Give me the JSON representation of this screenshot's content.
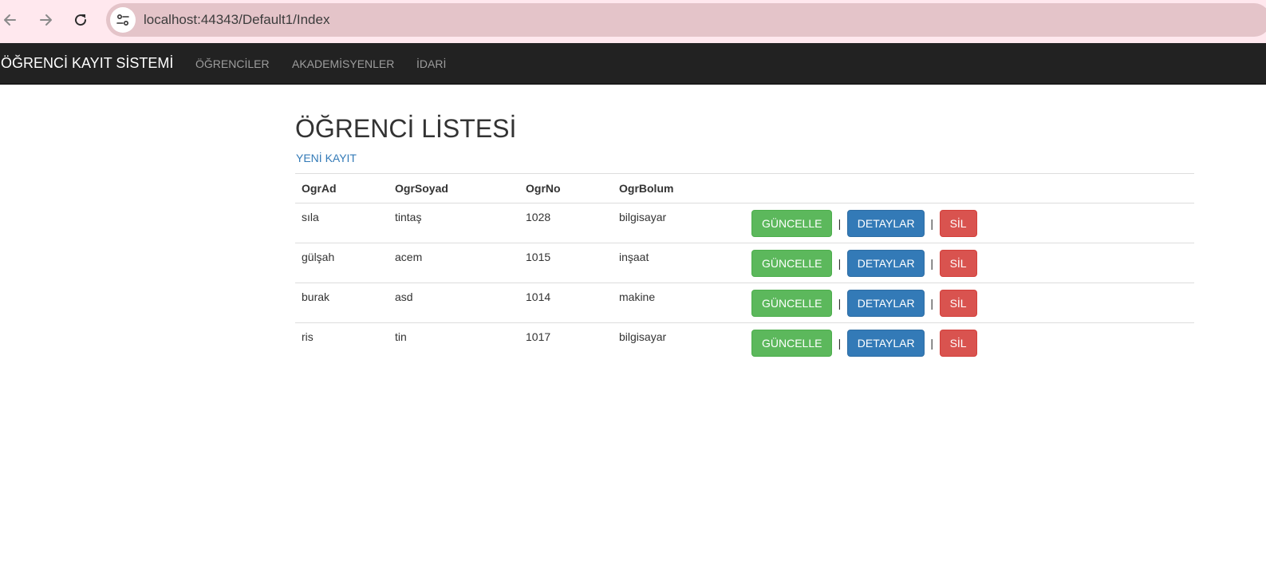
{
  "browser": {
    "url": "localhost:44343/Default1/Index",
    "icons": {
      "back": "arrow-left-icon",
      "forward": "arrow-right-icon",
      "reload": "reload-icon",
      "site_info": "tune-icon"
    }
  },
  "navbar": {
    "brand": "ÖĞRENCİ KAYIT SİSTEMİ",
    "links": [
      "ÖĞRENCİLER",
      "AKADEMİSYENLER",
      "İDARİ"
    ]
  },
  "main": {
    "title": "ÖĞRENCİ LİSTESİ",
    "new_record_link": "YENİ KAYIT",
    "table": {
      "headers": [
        "OgrAd",
        "OgrSoyad",
        "OgrNo",
        "OgrBolum"
      ],
      "rows": [
        [
          "sıla",
          "tintaş",
          "1028",
          "bilgisayar"
        ],
        [
          "gülşah",
          "acem",
          "1015",
          "inşaat"
        ],
        [
          "burak",
          "asd",
          "1014",
          "makine"
        ],
        [
          "ris",
          "tin",
          "1017",
          "bilgisayar"
        ]
      ],
      "actions": {
        "update": "GÜNCELLE",
        "details": "DETAYLAR",
        "delete": "SİL",
        "separator": "|"
      }
    }
  },
  "colors": {
    "navbar_bg": "#222222",
    "link": "#337ab7",
    "success": "#5cb85c",
    "primary": "#337ab7",
    "danger": "#d9534f",
    "browser_bar": "#ffe8ee",
    "omnibox": "#e4c4c9"
  }
}
